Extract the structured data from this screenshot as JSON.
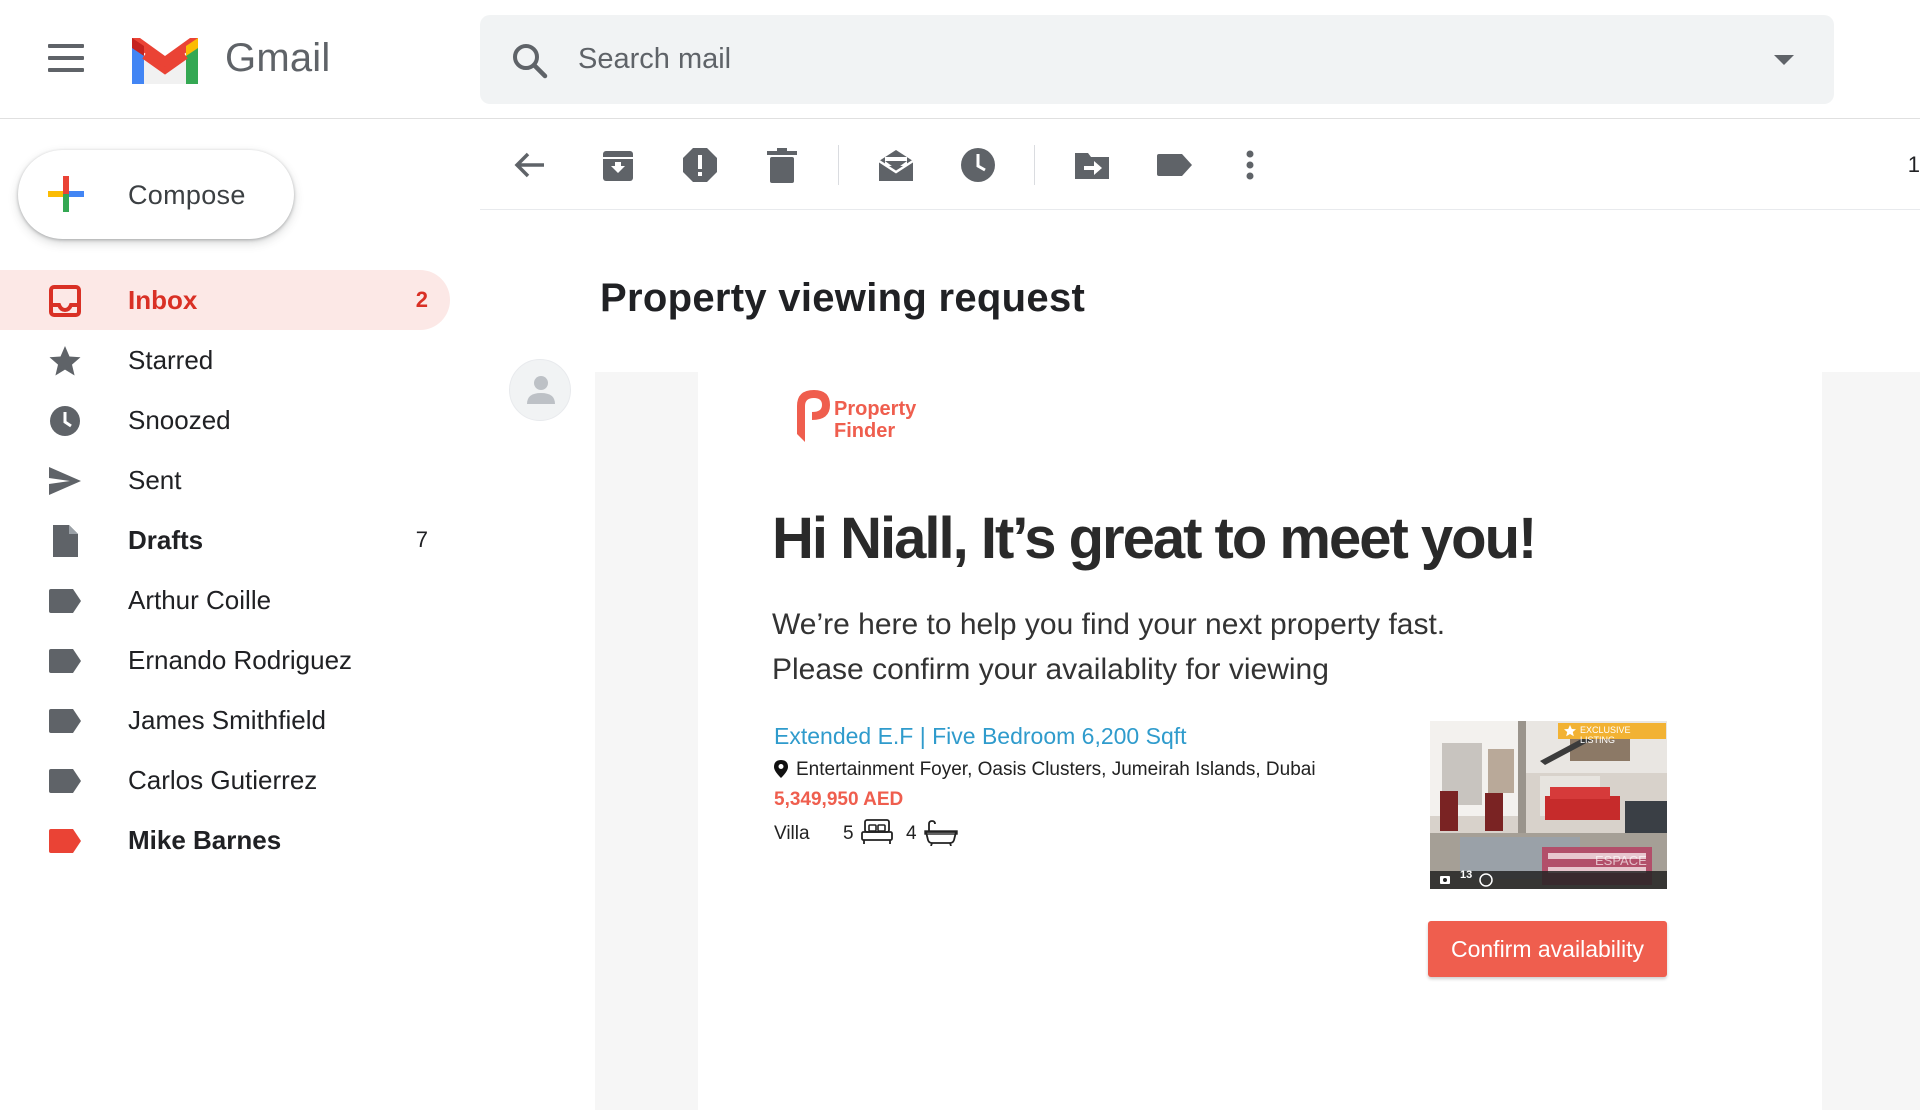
{
  "app": {
    "name": "Gmail"
  },
  "search": {
    "placeholder": "Search mail"
  },
  "compose": {
    "label": "Compose"
  },
  "sidebar": {
    "items": [
      {
        "label": "Inbox",
        "count": "2",
        "icon": "inbox-icon"
      },
      {
        "label": "Starred",
        "count": "",
        "icon": "star-icon"
      },
      {
        "label": "Snoozed",
        "count": "",
        "icon": "clock-icon"
      },
      {
        "label": "Sent",
        "count": "",
        "icon": "send-icon"
      },
      {
        "label": "Drafts",
        "count": "7",
        "icon": "draft-icon"
      },
      {
        "label": "Arthur Coille",
        "count": "",
        "icon": "label-icon"
      },
      {
        "label": "Ernando Rodriguez",
        "count": "",
        "icon": "label-icon"
      },
      {
        "label": "James Smithfield",
        "count": "",
        "icon": "label-icon"
      },
      {
        "label": "Carlos Gutierrez",
        "count": "",
        "icon": "label-icon"
      },
      {
        "label": "Mike Barnes",
        "count": "",
        "icon": "label-icon"
      }
    ]
  },
  "toolbar": {
    "buttons": [
      "back-icon",
      "archive-icon",
      "report-spam-icon",
      "delete-icon",
      "mark-unread-icon",
      "snooze-icon",
      "move-to-icon",
      "labels-icon",
      "more-icon"
    ],
    "page_indicator": "1"
  },
  "message": {
    "subject": "Property viewing request",
    "brand": {
      "line1": "Property",
      "line2": "Finder",
      "color": "#ef5e4e"
    },
    "greeting": "Hi Niall, It’s great to meet you!",
    "intro_line1": "We’re here to help you find your next property fast.",
    "intro_line2": "Please confirm your availablity for viewing",
    "listing": {
      "title": "Extended E.F | Five Bedroom 6,200 Sqft",
      "location": "Entertainment Foyer, Oasis Clusters, Jumeirah Islands, Dubai",
      "price": "5,349,950 AED",
      "type": "Villa",
      "bedrooms": "5",
      "bathrooms": "4",
      "badge": "EXCLUSIVE LISTING",
      "photo_count": "13",
      "watermark": "ESPACE"
    },
    "cta": "Confirm availability"
  },
  "colors": {
    "gmail_red": "#d93025",
    "inbox_bg": "#fce8e6",
    "brand_red": "#ef5e4e",
    "link_blue": "#2f9bcc",
    "mike_barnes_label": "#ea4335"
  }
}
